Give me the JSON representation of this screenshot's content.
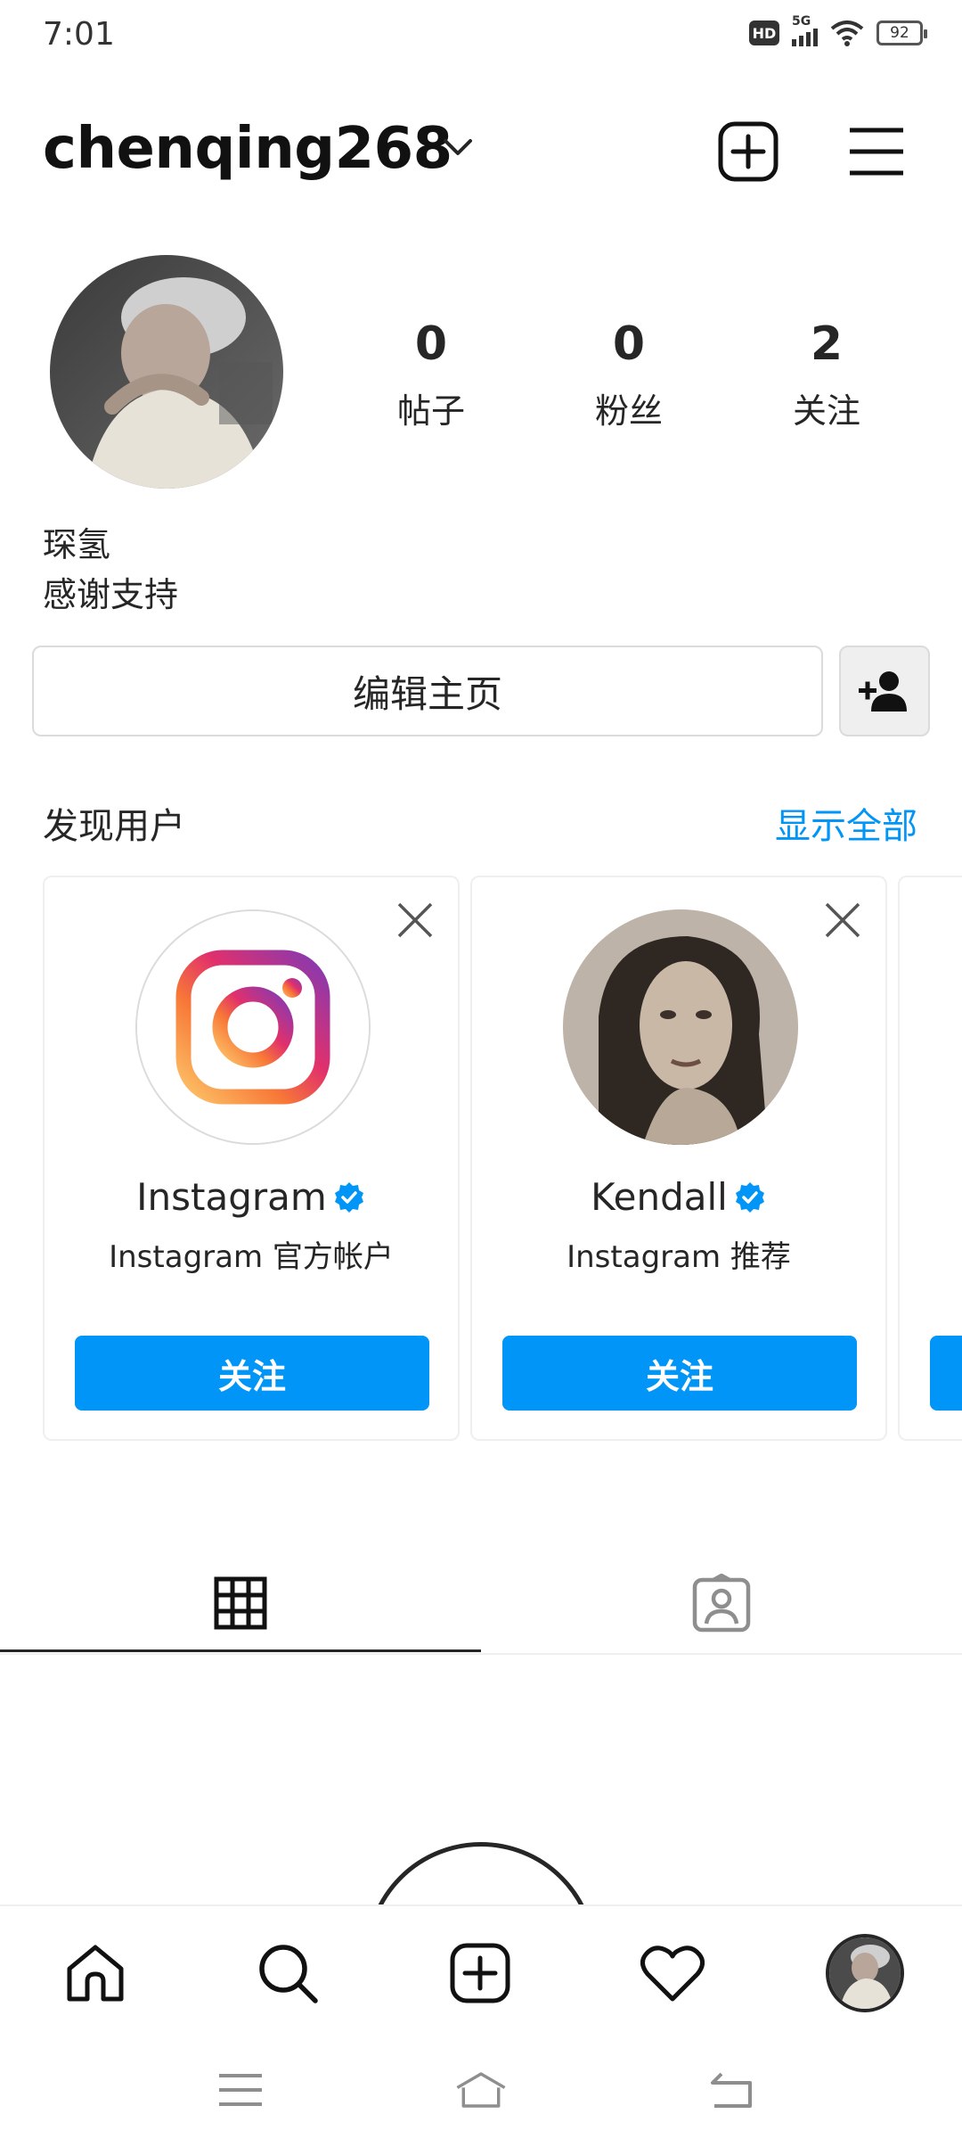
{
  "status_bar": {
    "time": "7:01",
    "hd": "HD",
    "network": "5G",
    "battery": "92"
  },
  "header": {
    "username": "chenqing268"
  },
  "profile": {
    "posts_count": "0",
    "posts_label": "帖子",
    "followers_count": "0",
    "followers_label": "粉丝",
    "following_count": "2",
    "following_label": "关注",
    "name": "琛氢",
    "bio": "感谢支持",
    "edit_label": "编辑主页"
  },
  "discover": {
    "title": "发现用户",
    "show_all": "显示全部",
    "cards": [
      {
        "name": "Instagram",
        "subtitle": "Instagram 官方帐户",
        "follow": "关注"
      },
      {
        "name": "Kendall",
        "subtitle": "Instagram 推荐",
        "follow": "关注"
      }
    ]
  },
  "colors": {
    "accent": "#0095f6",
    "verified": "#0095f6",
    "text": "#262626",
    "border": "#dbdbdb"
  },
  "icons": {
    "header": [
      "chevron-down-icon",
      "new-post-icon",
      "menu-icon"
    ],
    "tabs": [
      "grid-icon",
      "tagged-icon"
    ],
    "bottom_nav": [
      "home-icon",
      "search-icon",
      "create-icon",
      "heart-icon",
      "profile-avatar"
    ],
    "system": [
      "recents-icon",
      "home-key-icon",
      "back-icon"
    ]
  }
}
